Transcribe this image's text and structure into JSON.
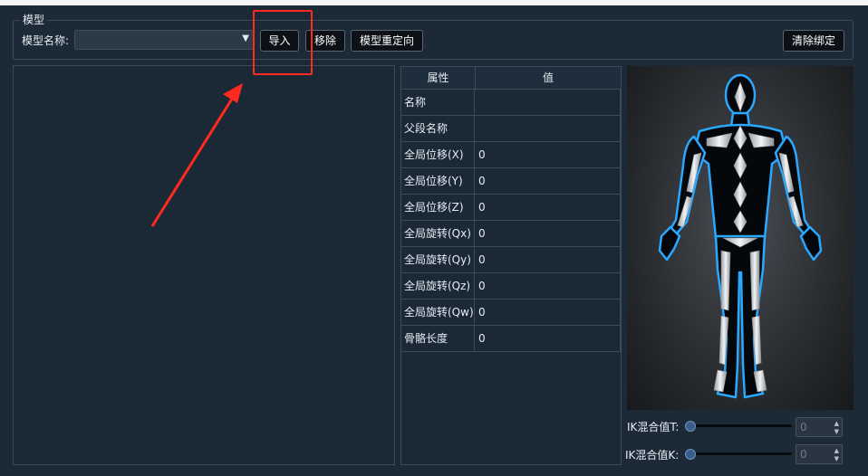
{
  "model_group": {
    "title": "模型",
    "name_label": "模型名称:",
    "name_value": "",
    "buttons": {
      "import": "导入",
      "remove": "移除",
      "retarget": "模型重定向",
      "clear_binding": "清除绑定"
    }
  },
  "properties": {
    "headers": [
      "属性",
      "值"
    ],
    "rows": [
      {
        "key": "名称",
        "value": ""
      },
      {
        "key": "父段名称",
        "value": ""
      },
      {
        "key": "全局位移(X)",
        "value": "0"
      },
      {
        "key": "全局位移(Y)",
        "value": "0"
      },
      {
        "key": "全局位移(Z)",
        "value": "0"
      },
      {
        "key": "全局旋转(Qx)",
        "value": "0"
      },
      {
        "key": "全局旋转(Qy)",
        "value": "0"
      },
      {
        "key": "全局旋转(Qz)",
        "value": "0"
      },
      {
        "key": "全局旋转(Qw)",
        "value": "0"
      },
      {
        "key": "骨骼长度",
        "value": "0"
      }
    ]
  },
  "ik": {
    "t_label": "IK混合值T:",
    "t_value": "0",
    "t_level": 0,
    "k_label": "IK混合值K:",
    "k_value": "0",
    "k_level": 0
  },
  "colors": {
    "annotation": "#ff2a1f",
    "figure_glow": "#2aa8ff"
  }
}
